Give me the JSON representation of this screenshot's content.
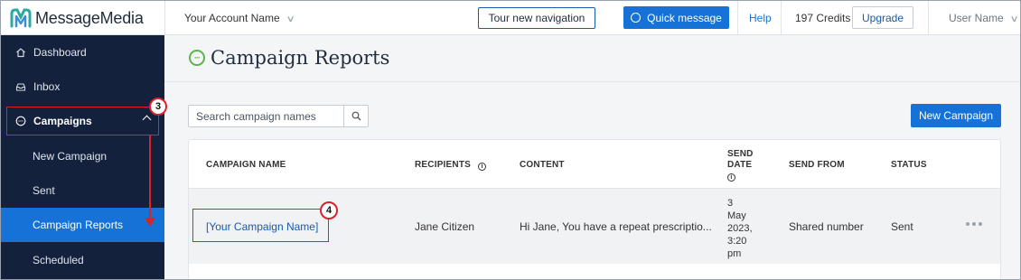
{
  "app": {
    "brand": "MessageMedia"
  },
  "topbar": {
    "account_label": "Your Account Name",
    "tour_label": "Tour new navigation",
    "quick_message_label": "Quick message",
    "help_label": "Help",
    "credits_label": "197 Credits",
    "upgrade_label": "Upgrade",
    "user_label": "User Name"
  },
  "sidebar": {
    "items": [
      {
        "label": "Dashboard",
        "icon": "home-icon"
      },
      {
        "label": "Inbox",
        "icon": "inbox-icon"
      },
      {
        "label": "Campaigns",
        "icon": "campaign-icon",
        "expanded": true
      },
      {
        "label": "New Campaign"
      },
      {
        "label": "Sent"
      },
      {
        "label": "Campaign Reports",
        "active": true
      },
      {
        "label": "Scheduled"
      }
    ]
  },
  "page": {
    "title": "Campaign Reports",
    "search_placeholder": "Search campaign names",
    "new_campaign_label": "New Campaign"
  },
  "table": {
    "columns": [
      "CAMPAIGN NAME",
      "RECIPIENTS",
      "CONTENT",
      "SEND DATE",
      "SEND FROM",
      "STATUS"
    ],
    "rows": [
      {
        "campaign_name": "[Your Campaign Name]",
        "recipients": "Jane Citizen",
        "content": "Hi Jane, You have a repeat prescriptio...",
        "send_date_lines": [
          "3",
          "May",
          "2023,",
          "3:20",
          "pm"
        ],
        "send_from": "Shared number",
        "status": "Sent"
      }
    ]
  },
  "annotations": {
    "step_a": "3",
    "step_b": "4"
  },
  "colors": {
    "primary": "#1672d6",
    "sidebar": "#14213d",
    "annotation": "#d9222a",
    "brand_green": "#5bb54d"
  }
}
